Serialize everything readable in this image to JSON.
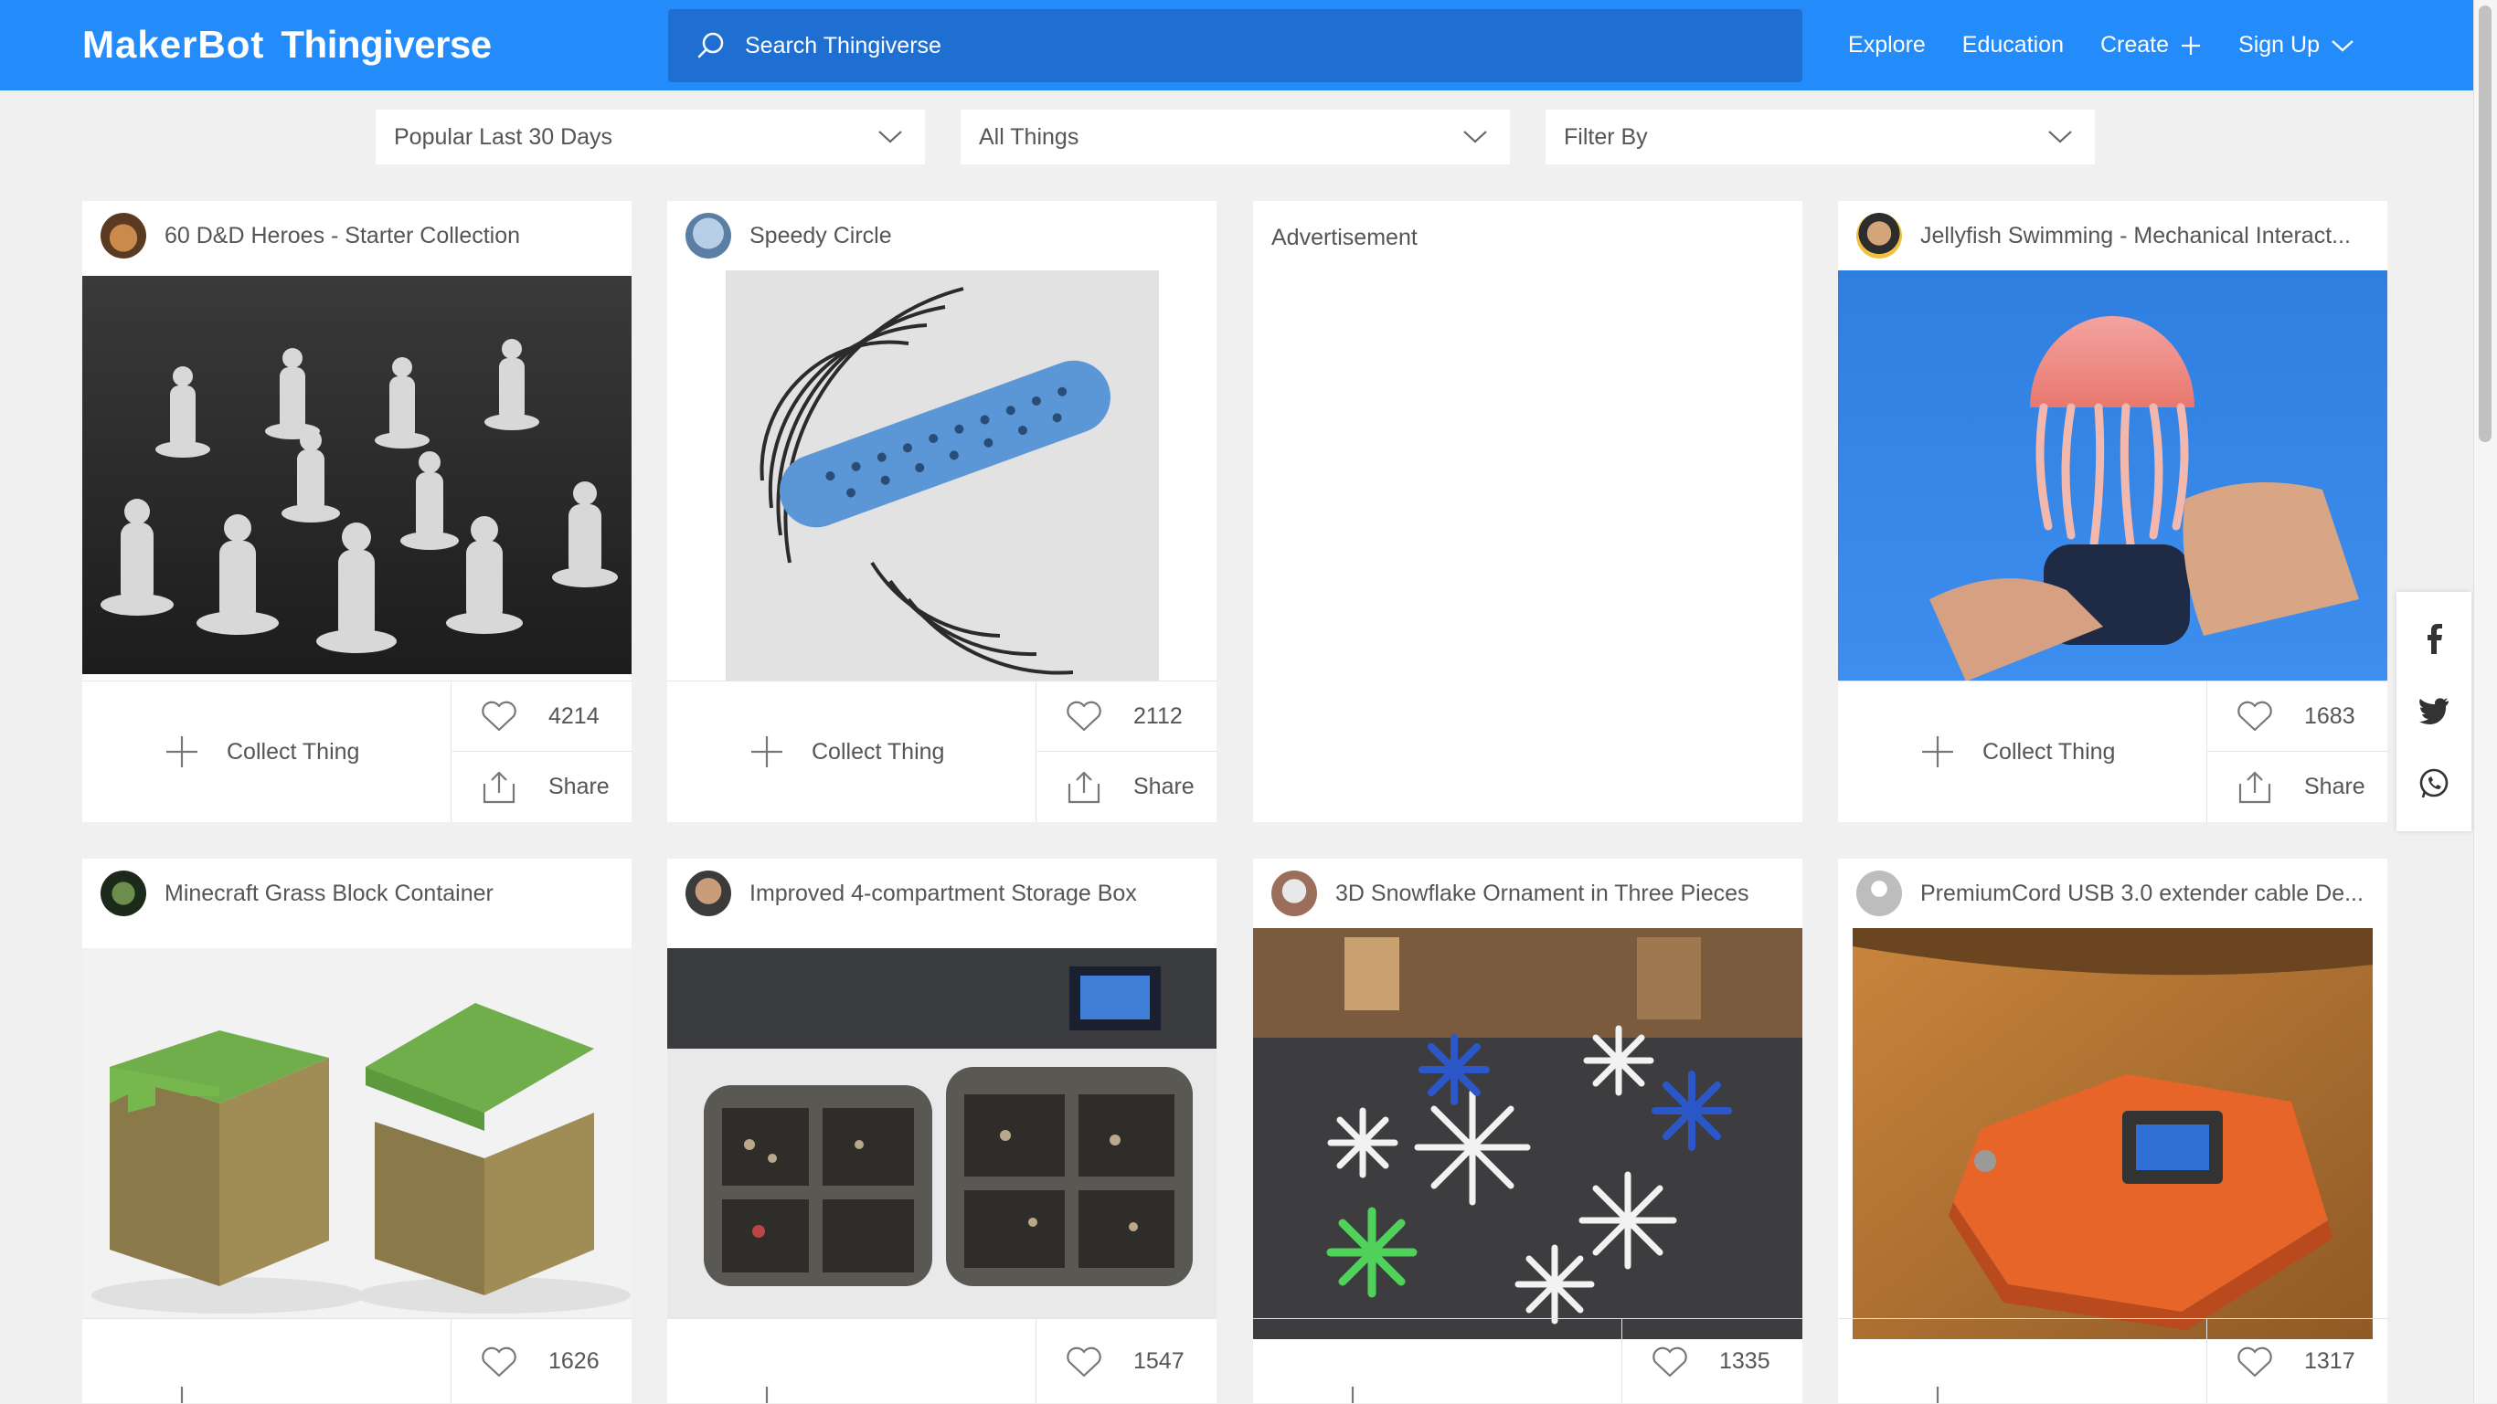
{
  "header": {
    "logo_maker": "MakerBot",
    "logo_thing": "Thingiverse",
    "search_placeholder": "Search Thingiverse",
    "nav": {
      "explore": "Explore",
      "education": "Education",
      "create": "Create",
      "signup": "Sign Up"
    }
  },
  "filters": {
    "sort": "Popular Last 30 Days",
    "type": "All Things",
    "filter_by": "Filter By"
  },
  "cards": [
    {
      "title": "60 D&D Heroes - Starter Collection",
      "collect": "Collect Thing",
      "likes": "4214",
      "share": "Share"
    },
    {
      "title": "Speedy Circle",
      "collect": "Collect Thing",
      "likes": "2112",
      "share": "Share"
    },
    {
      "title": "Jellyfish Swimming - Mechanical Interact...",
      "collect": "Collect Thing",
      "likes": "1683",
      "share": "Share"
    },
    {
      "title": "Minecraft Grass Block Container",
      "likes": "1626"
    },
    {
      "title": "Improved 4-compartment Storage Box",
      "likes": "1547"
    },
    {
      "title": "3D Snowflake Ornament in Three Pieces",
      "likes": "1335"
    },
    {
      "title": "PremiumCord USB 3.0 extender cable De...",
      "likes": "1317"
    }
  ],
  "advertisement_label": "Advertisement",
  "colors": {
    "brand_blue": "#248bfb",
    "search_bg": "#1f6fd3"
  }
}
